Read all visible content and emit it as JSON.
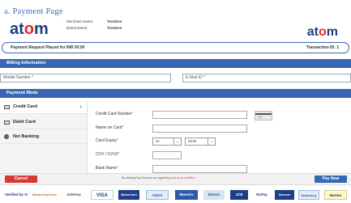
{
  "caption": "a.  Payment Page",
  "header": {
    "logo_left": {
      "pre": "at",
      "o": "o",
      "post": "m",
      "tagline": ""
    },
    "merchant_name_label": "Merchant Name:",
    "merchant_name_value": "Testdom",
    "brand_name_label": "Brand Name:",
    "brand_name_value": "Testdom",
    "logo_right": {
      "pre": "at",
      "o": "o",
      "post": "m"
    },
    "payment_request": "Payment Request Placed for INR 00.00",
    "transaction_id": "Transaction ID: 1"
  },
  "billing": {
    "title": "Billing Information",
    "mobile_placeholder": "Mobile Number *",
    "email_placeholder": "E-Mail ID *"
  },
  "payment_mode": {
    "title": "Payment Mode",
    "options": [
      {
        "label": "Credit Card",
        "icon": "card-icon"
      },
      {
        "label": "Debit Card",
        "icon": "card-icon"
      },
      {
        "label": "Net Banking",
        "icon": "globe-icon"
      }
    ]
  },
  "card_form": {
    "number_label": "Credit Card Number",
    "name_label": "Name on Card",
    "expiry_label": "Card Expiry",
    "expiry_month": "01",
    "expiry_year": "2018",
    "cvv_label": "CVV / CVV2",
    "bank_label": "Bank Name",
    "required_mark": "*"
  },
  "footer": {
    "cancel_label": "Cancel",
    "agree_text": "By clicking Pay Now you are agreeing to",
    "agree_link": "terms & condition",
    "pay_label": "Pay Now"
  },
  "brand_logos": [
    "Verified by VISA",
    "MasterCard SecureCode",
    "SafeKey",
    "VISA",
    "MasterCard",
    "AMEX",
    "Maestro",
    "Diners",
    "JCB",
    "RuPay",
    "Discover",
    "Netbanking",
    "Norton"
  ],
  "colors": {
    "primary": "#3868b3",
    "cancel": "#d43a36",
    "logo_dark": "#1c3f86",
    "logo_accent": "#e8282b"
  }
}
